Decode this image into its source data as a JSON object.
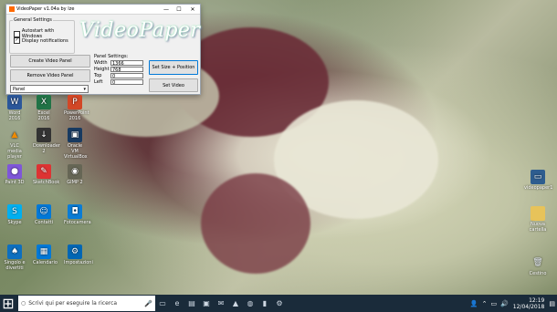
{
  "window": {
    "title": "VideoPaper v1.04a by Ize",
    "controls": {
      "minimize": "—",
      "maximize": "☐",
      "close": "✕"
    },
    "general_settings": {
      "legend": "General Settings",
      "autostart_label": "Autostart with Windows",
      "autostart_checked": false,
      "notifications_label": "Display notifications",
      "notifications_checked": true
    },
    "logo_text": "VideoPaper",
    "buttons": {
      "create": "Create Video Panel",
      "remove": "Remove Video Panel",
      "set_size": "Set Size + Position",
      "set_video": "Set Video"
    },
    "dropdown": {
      "value": "Panel"
    },
    "panel_settings": {
      "label": "Panel Settings:",
      "width_label": "Width",
      "width_value": "1366",
      "height_label": "Height",
      "height_value": "768",
      "top_label": "Top",
      "top_value": "0",
      "left_label": "Left",
      "left_value": "0"
    }
  },
  "desktop_icons": [
    {
      "label": "Word 2016",
      "icon": "word-icon",
      "color": "#2b579a"
    },
    {
      "label": "Excel 2016",
      "icon": "excel-icon",
      "color": "#217346"
    },
    {
      "label": "PowerPoint 2016",
      "icon": "powerpoint-icon",
      "color": "#d24726"
    },
    {
      "label": "VLC media player",
      "icon": "vlc-icon",
      "color": "#f08a00"
    },
    {
      "label": "Downloader 2",
      "icon": "downloader-icon",
      "color": "#444"
    },
    {
      "label": "Oracle VM VirtualBox",
      "icon": "virtualbox-icon",
      "color": "#183a61"
    },
    {
      "label": "Paint 3D",
      "icon": "paint3d-icon",
      "color": "#7f56d9"
    },
    {
      "label": "SketchBook",
      "icon": "sketchbook-icon",
      "color": "#d33"
    },
    {
      "label": "GIMP 2",
      "icon": "gimp-icon",
      "color": "#665"
    },
    {
      "label": "Skype",
      "icon": "skype-icon",
      "color": "#00aff0"
    },
    {
      "label": "Contatti",
      "icon": "contacts-icon",
      "color": "#0078d7"
    },
    {
      "label": "Fotocamera",
      "icon": "camera-icon",
      "color": "#0a7cd5"
    },
    {
      "label": "Singolo e divertiti",
      "icon": "solitaire-icon",
      "color": "#0d6fbf"
    },
    {
      "label": "Calendario",
      "icon": "calendar-icon",
      "color": "#0078d7"
    },
    {
      "label": "Impostazioni",
      "icon": "settings-icon",
      "color": "#0066b4"
    },
    {
      "label": "videopaper1",
      "icon": "videopaper-file-icon",
      "color": "#2e5d8f"
    },
    {
      "label": "Nuova cartella",
      "icon": "folder-icon",
      "color": "#e7c35a"
    },
    {
      "label": "Cestino",
      "icon": "recycle-bin-icon",
      "color": "#cfd6dd"
    }
  ],
  "taskbar": {
    "search_placeholder": "Scrivi qui per eseguire la ricerca",
    "time": "12:19",
    "date": "12/04/2018"
  }
}
